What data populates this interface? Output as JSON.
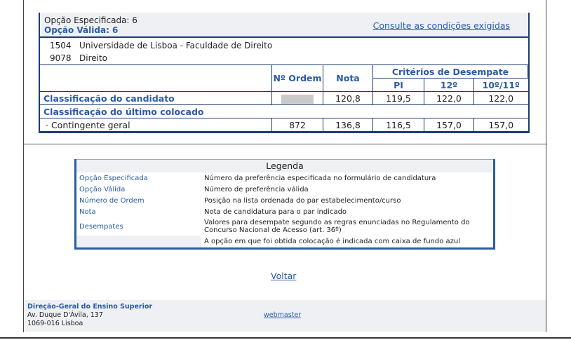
{
  "result": {
    "opcao_especificada": "Opção Especificada: 6",
    "opcao_valida": "Opção Válida: 6",
    "consult_link": "Consulte as condições exigidas",
    "institution_code": "1504",
    "institution_name": "Universidade de Lisboa - Faculdade de Direito",
    "course_code": "9078",
    "course_name": "Direito"
  },
  "table": {
    "col_ordem": "Nº Ordem",
    "col_nota": "Nota",
    "col_criterios": "Critérios de Desempate",
    "col_pi": "PI",
    "col_12": "12º",
    "col_10_11": "10º/11º",
    "row_candidato": {
      "label": "Classificação do candidato",
      "nota": "120,8",
      "pi": "119,5",
      "c12": "122,0",
      "c1011": "122,0"
    },
    "row_ultimo": {
      "label": "Classificação do último colocado"
    },
    "row_contingente": {
      "label": "· Contingente geral",
      "ordem": "872",
      "nota": "136,8",
      "pi": "116,5",
      "c12": "157,0",
      "c1011": "157,0"
    }
  },
  "legend": {
    "title": "Legenda",
    "rows": [
      {
        "key": "Opção Especificada",
        "value": "Número da preferência especificada no formulário de candidatura"
      },
      {
        "key": "Opção Válida",
        "value": "Número de preferência válida"
      },
      {
        "key": "Número de Ordem",
        "value": "Posição na lista ordenada do par estabelecimento/curso"
      },
      {
        "key": "Nota",
        "value": "Nota de candidatura para o par indicado"
      },
      {
        "key": "Desempates",
        "value": "Valores para desempate segundo as regras enunciadas no Regulamento do Concurso Nacional de Acesso (art. 36º)"
      },
      {
        "key": "",
        "value": "A opção em que foi obtida colocação é indicada com caixa de fundo azul"
      }
    ]
  },
  "voltar": "Voltar",
  "footer": {
    "org": "Direção-Geral do Ensino Superior",
    "address1": "Av. Duque D'Ávila, 137",
    "address2": "1069-016 Lisboa",
    "webmaster": "webmaster"
  },
  "colors": {
    "accent": "#2a5ba6",
    "border": "#1e3c72",
    "header_bg": "#eef0f3"
  }
}
